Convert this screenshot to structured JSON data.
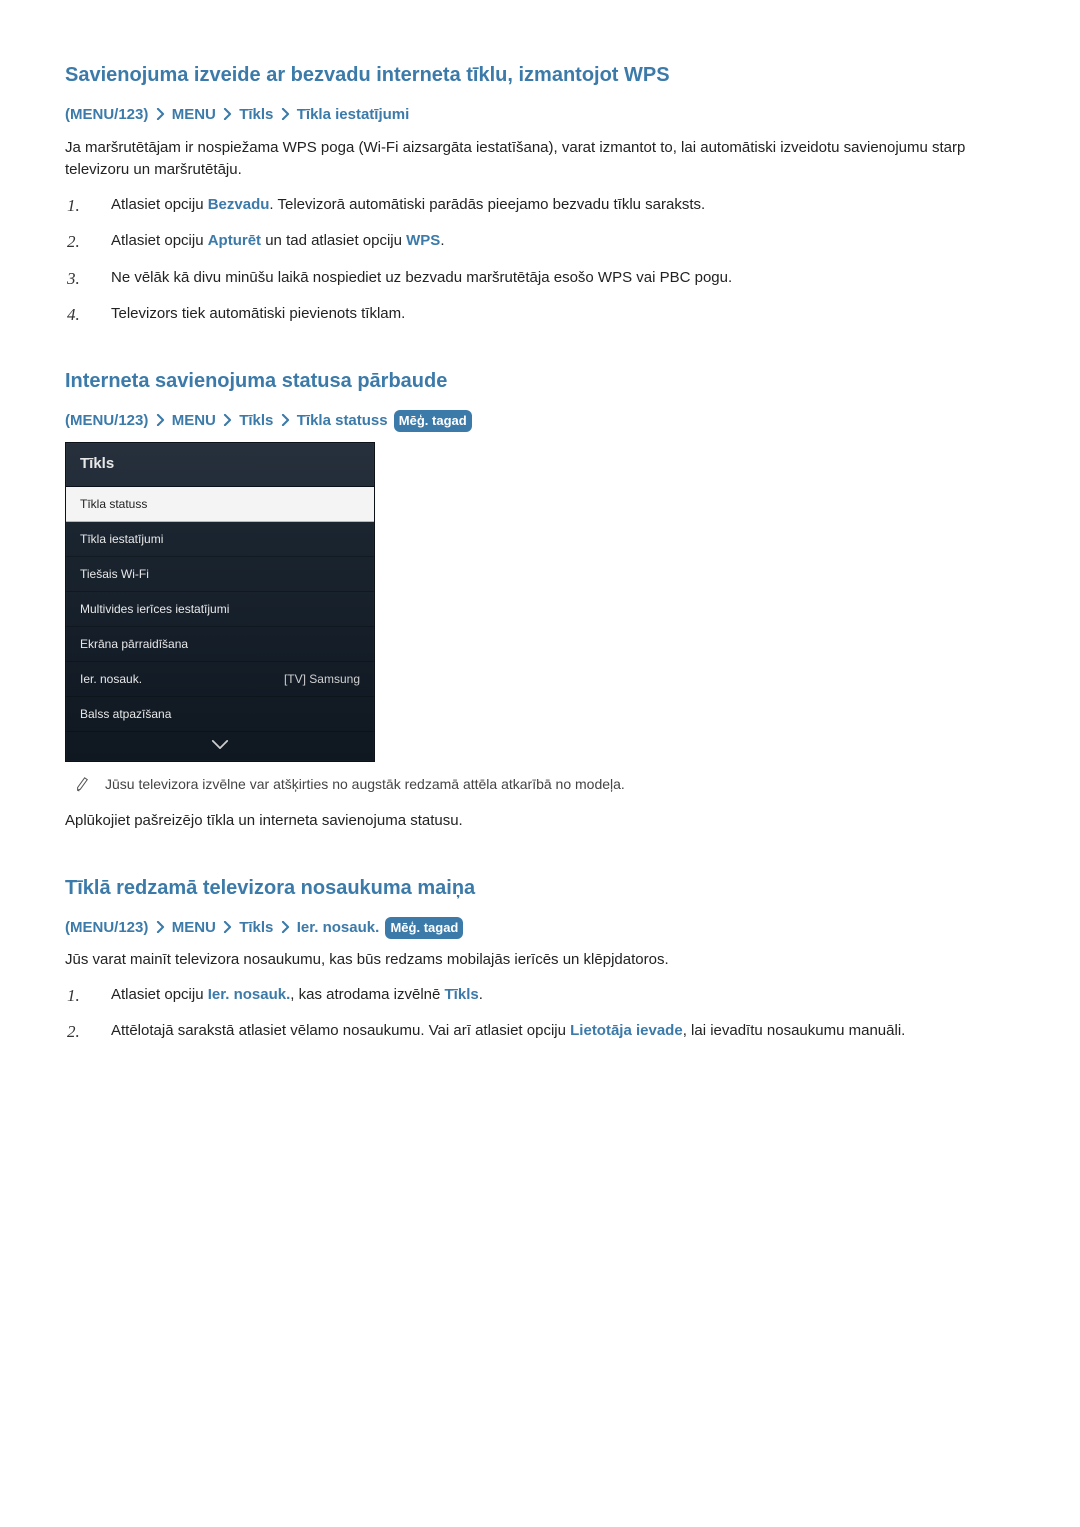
{
  "section1": {
    "heading": "Savienojuma izveide ar bezvadu interneta tīklu, izmantojot WPS",
    "bc": {
      "p1": "(",
      "a": "MENU/123",
      "p2": ")",
      "b": "MENU",
      "c": "Tīkls",
      "d": "Tīkla iestatījumi"
    },
    "intro": "Ja maršrutētājam ir nospiežama WPS poga (Wi-Fi aizsargāta iestatīšana), varat izmantot to, lai automātiski izveidotu savienojumu starp televizoru un maršrutētāju.",
    "steps": [
      {
        "pre": "Atlasiet opciju ",
        "kw1": "Bezvadu",
        "post": ". Televizorā automātiski parādās pieejamo bezvadu tīklu saraksts."
      },
      {
        "pre": "Atlasiet opciju ",
        "kw1": "Apturēt",
        "mid": " un tad atlasiet opciju ",
        "kw2": "WPS",
        "post": "."
      },
      {
        "pre": "Ne vēlāk kā divu minūšu laikā nospiediet uz bezvadu maršrutētāja esošo WPS vai PBC pogu."
      },
      {
        "pre": "Televizors tiek automātiski pievienots tīklam."
      }
    ]
  },
  "section2": {
    "heading": "Interneta savienojuma statusa pārbaude",
    "bc": {
      "p1": "(",
      "a": "MENU/123",
      "p2": ")",
      "b": "MENU",
      "c": "Tīkls",
      "d": "Tīkla statuss",
      "try": "Mēģ. tagad"
    },
    "menu": {
      "title": "Tīkls",
      "items": [
        {
          "label": "Tīkla statuss",
          "value": "",
          "selected": true
        },
        {
          "label": "Tīkla iestatījumi",
          "value": ""
        },
        {
          "label": "Tiešais Wi-Fi",
          "value": ""
        },
        {
          "label": "Multivides ierīces iestatījumi",
          "value": ""
        },
        {
          "label": "Ekrāna pārraidīšana",
          "value": ""
        },
        {
          "label": "Ier. nosauk.",
          "value": "[TV] Samsung"
        },
        {
          "label": "Balss atpazīšana",
          "value": ""
        }
      ]
    },
    "note": "Jūsu televizora izvēlne var atšķirties no augstāk redzamā attēla atkarībā no modeļa.",
    "para": "Aplūkojiet pašreizējo tīkla un interneta savienojuma statusu."
  },
  "section3": {
    "heading": "Tīklā redzamā televizora nosaukuma maiņa",
    "bc": {
      "p1": "(",
      "a": "MENU/123",
      "p2": ")",
      "b": "MENU",
      "c": "Tīkls",
      "d": "Ier. nosauk.",
      "try": "Mēģ. tagad"
    },
    "intro": "Jūs varat mainīt televizora nosaukumu, kas būs redzams mobilajās ierīcēs un klēpjdatoros.",
    "steps": [
      {
        "pre": "Atlasiet opciju ",
        "kw1": "Ier. nosauk.",
        "mid": ", kas atrodama izvēlnē ",
        "kw2": "Tīkls",
        "post": "."
      },
      {
        "pre": "Attēlotajā sarakstā atlasiet vēlamo nosaukumu. Vai arī atlasiet opciju ",
        "kw1": "Lietotāja ievade",
        "post": ", lai ievadītu nosaukumu manuāli."
      }
    ]
  }
}
